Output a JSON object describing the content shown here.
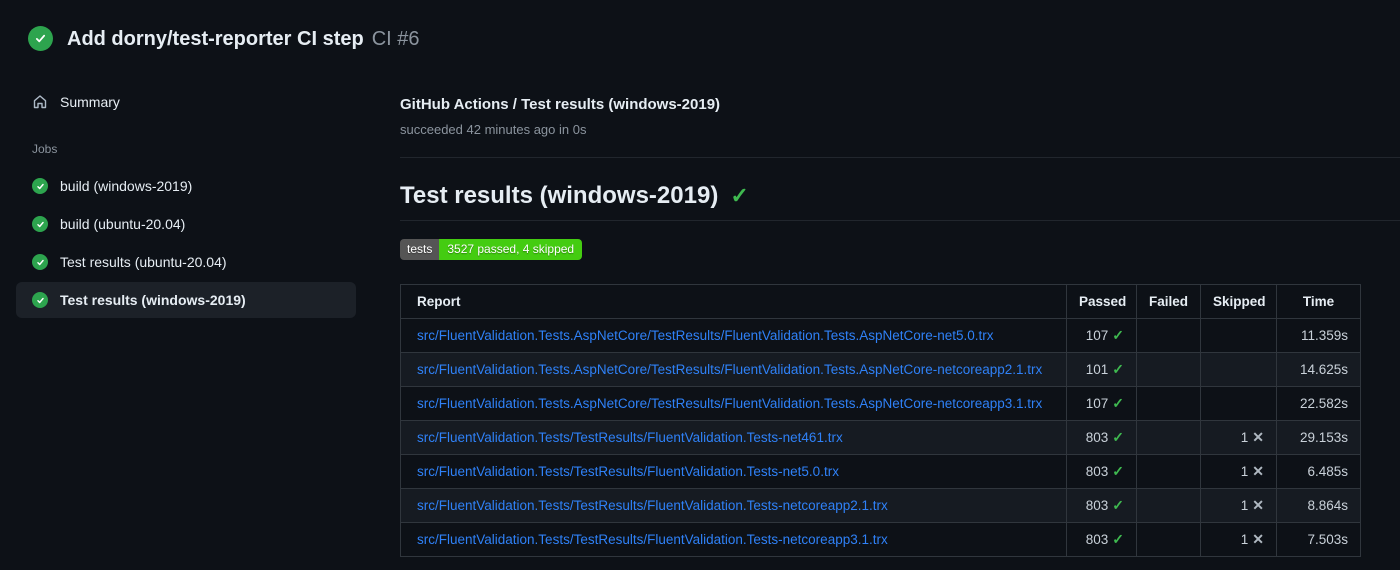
{
  "colors": {
    "background": "#0d1117",
    "success_green": "#2da44e",
    "check_green": "#3fb950",
    "link_blue": "#2f81f7",
    "badge_gray": "#555555",
    "badge_green": "#44cc11",
    "muted_text": "#8b949e"
  },
  "header": {
    "title": "Add dorny/test-reporter CI step",
    "run_number": "CI #6"
  },
  "sidebar": {
    "summary_label": "Summary",
    "jobs_label": "Jobs",
    "jobs": [
      {
        "label": "build (windows-2019)"
      },
      {
        "label": "build (ubuntu-20.04)"
      },
      {
        "label": "Test results (ubuntu-20.04)"
      },
      {
        "label": "Test results (windows-2019)"
      }
    ]
  },
  "main": {
    "job_title": "GitHub Actions / Test results (windows-2019)",
    "job_status": "succeeded 42 minutes ago in 0s",
    "heading": "Test results (windows-2019)",
    "badge": {
      "label": "tests",
      "value": "3527 passed, 4 skipped"
    },
    "table": {
      "headers": [
        "Report",
        "Passed",
        "Failed",
        "Skipped",
        "Time"
      ],
      "rows": [
        {
          "report": "src/FluentValidation.Tests.AspNetCore/TestResults/FluentValidation.Tests.AspNetCore-net5.0.trx",
          "passed": "107",
          "failed": "",
          "skipped": "",
          "time": "11.359s"
        },
        {
          "report": "src/FluentValidation.Tests.AspNetCore/TestResults/FluentValidation.Tests.AspNetCore-netcoreapp2.1.trx",
          "passed": "101",
          "failed": "",
          "skipped": "",
          "time": "14.625s"
        },
        {
          "report": "src/FluentValidation.Tests.AspNetCore/TestResults/FluentValidation.Tests.AspNetCore-netcoreapp3.1.trx",
          "passed": "107",
          "failed": "",
          "skipped": "",
          "time": "22.582s"
        },
        {
          "report": "src/FluentValidation.Tests/TestResults/FluentValidation.Tests-net461.trx",
          "passed": "803",
          "failed": "",
          "skipped": "1",
          "time": "29.153s"
        },
        {
          "report": "src/FluentValidation.Tests/TestResults/FluentValidation.Tests-net5.0.trx",
          "passed": "803",
          "failed": "",
          "skipped": "1",
          "time": "6.485s"
        },
        {
          "report": "src/FluentValidation.Tests/TestResults/FluentValidation.Tests-netcoreapp2.1.trx",
          "passed": "803",
          "failed": "",
          "skipped": "1",
          "time": "8.864s"
        },
        {
          "report": "src/FluentValidation.Tests/TestResults/FluentValidation.Tests-netcoreapp3.1.trx",
          "passed": "803",
          "failed": "",
          "skipped": "1",
          "time": "7.503s"
        }
      ]
    }
  }
}
